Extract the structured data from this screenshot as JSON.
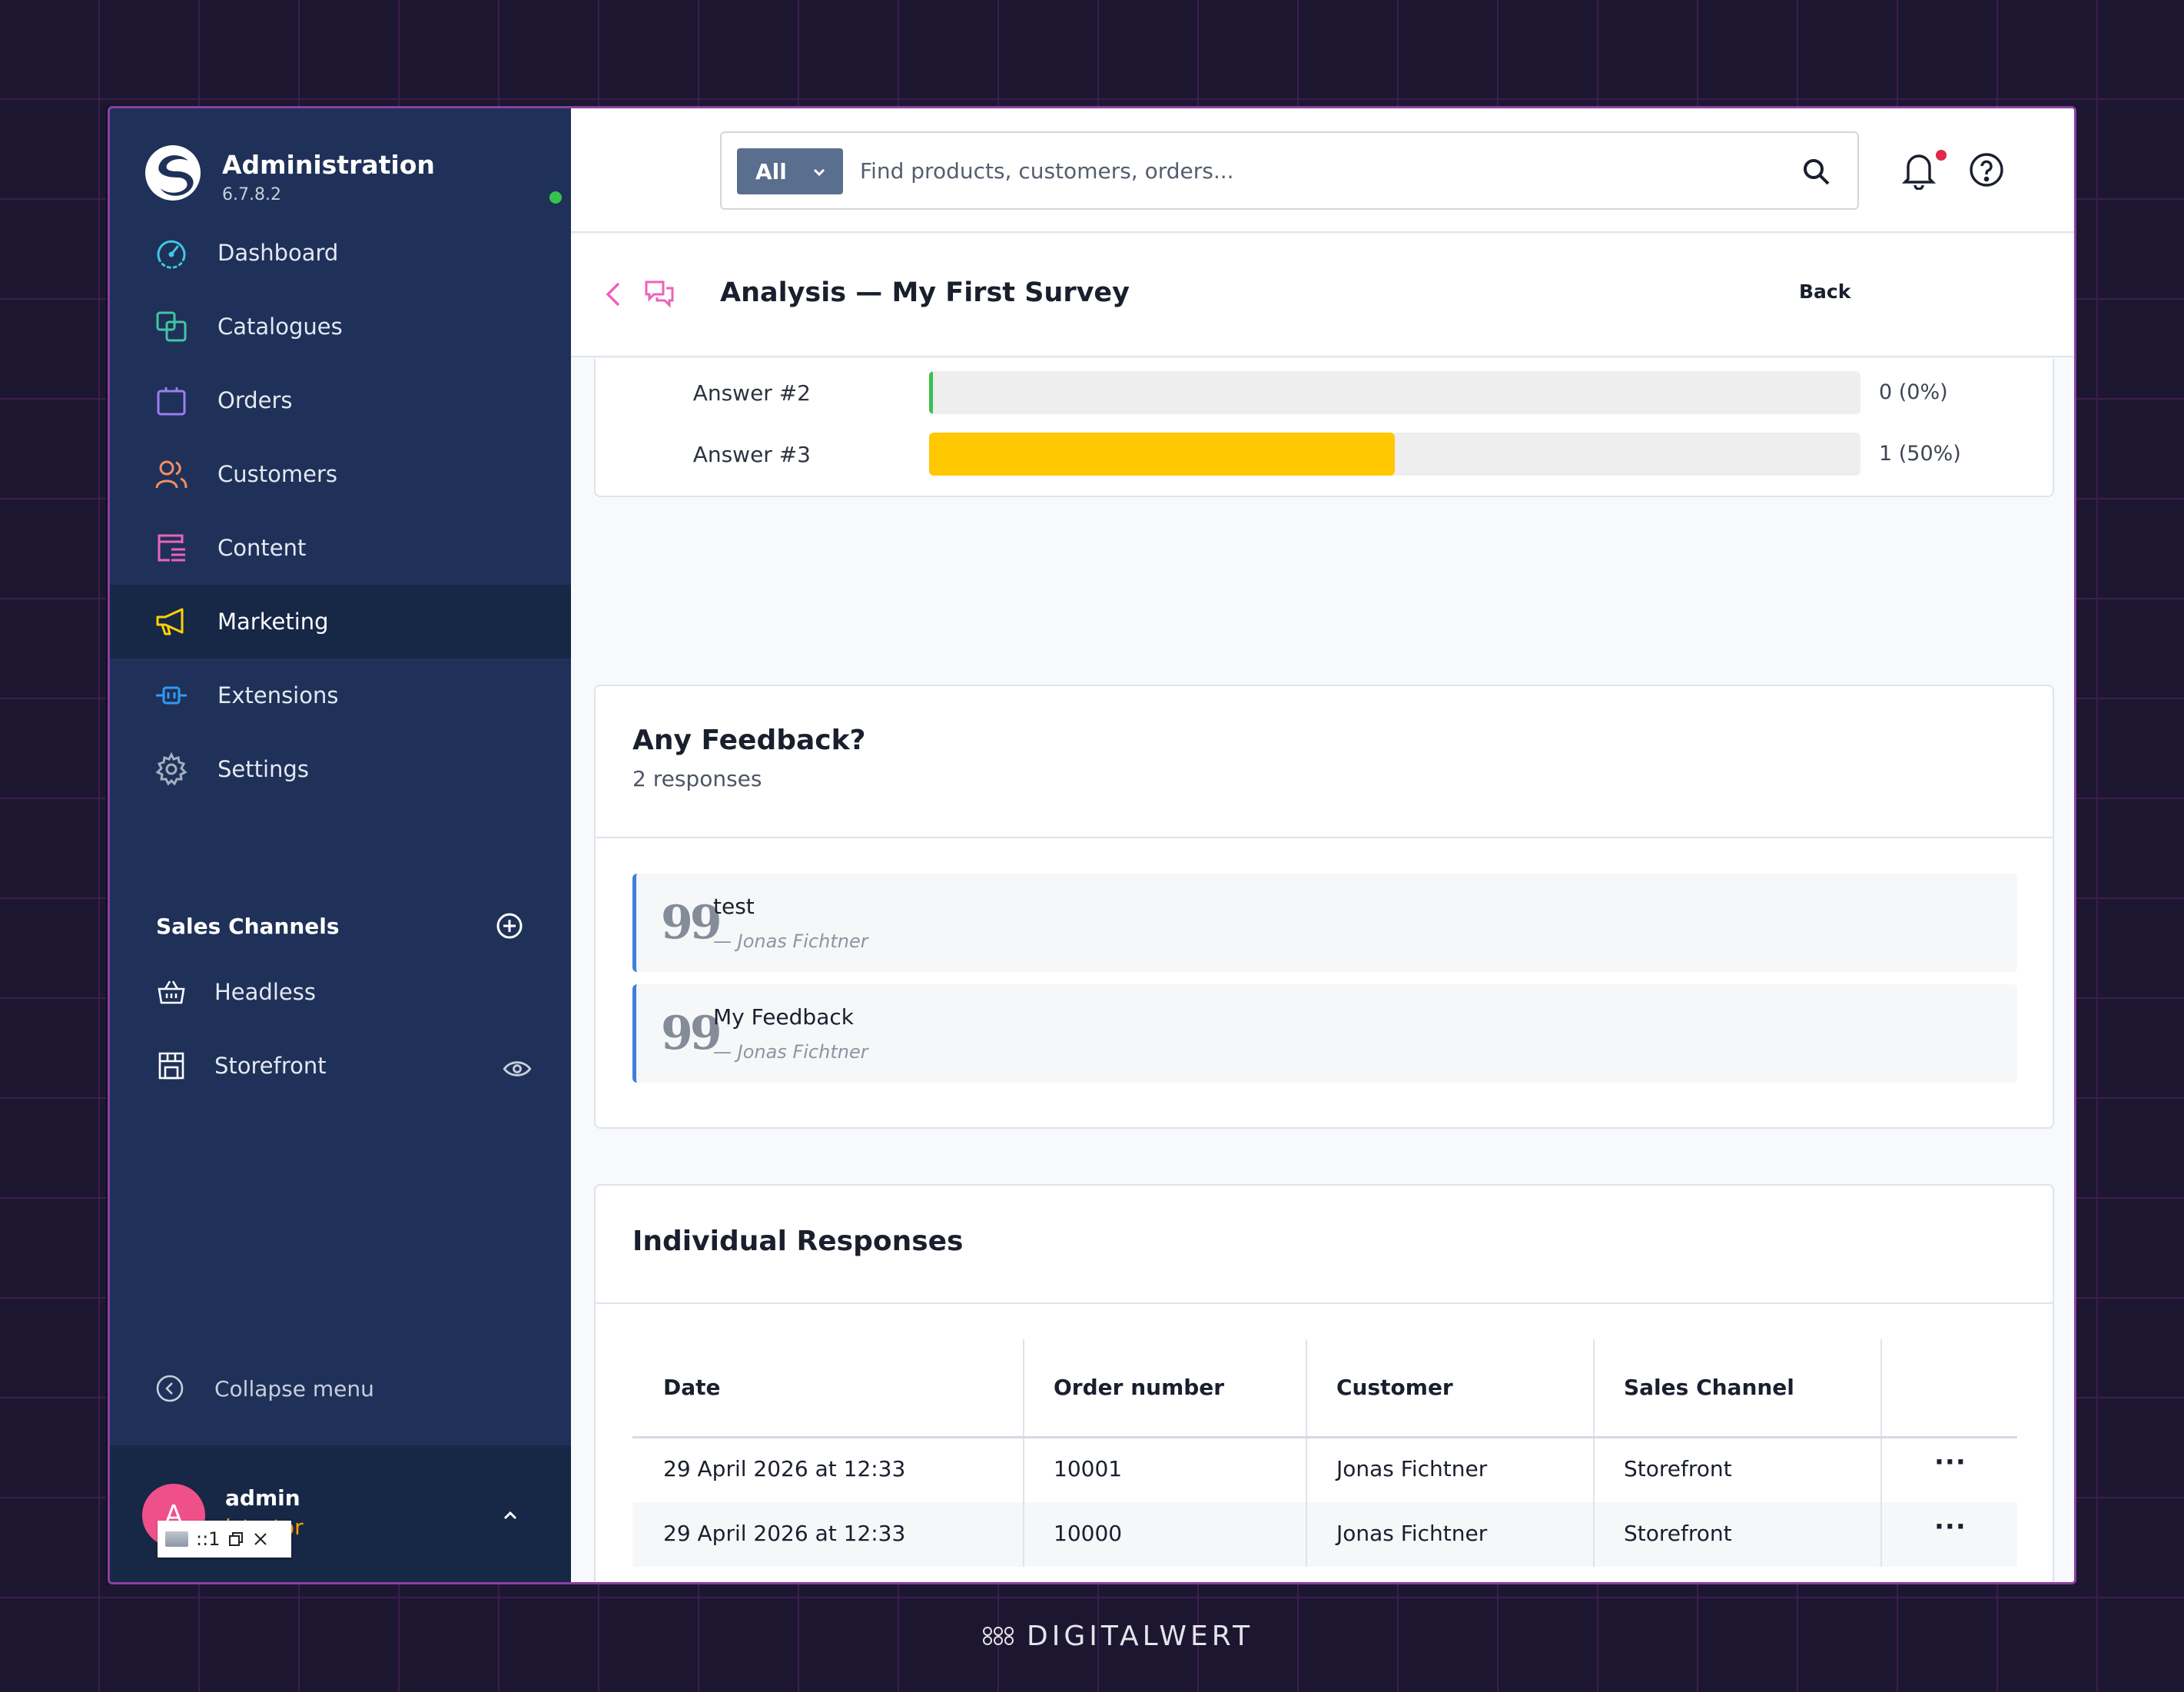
{
  "sidebar": {
    "brand_title": "Administration",
    "version": "6.7.8.2",
    "nav": [
      {
        "label": "Dashboard",
        "icon": "gauge-icon",
        "color": "#3fc8e4"
      },
      {
        "label": "Catalogues",
        "icon": "catalogue-icon",
        "color": "#42c6a4"
      },
      {
        "label": "Orders",
        "icon": "shopping-bag-icon",
        "color": "#9b7ef0"
      },
      {
        "label": "Customers",
        "icon": "users-icon",
        "color": "#f58e63"
      },
      {
        "label": "Content",
        "icon": "content-icon",
        "color": "#ee62b9"
      },
      {
        "label": "Marketing",
        "icon": "megaphone-icon",
        "color": "#ffd100",
        "active": true
      },
      {
        "label": "Extensions",
        "icon": "plugin-icon",
        "color": "#2f9bf5"
      },
      {
        "label": "Settings",
        "icon": "gear-icon",
        "color": "#a6aec0"
      }
    ],
    "sales_channels_title": "Sales Channels",
    "channels": [
      {
        "label": "Headless",
        "icon": "basket-icon"
      },
      {
        "label": "Storefront",
        "icon": "storefront-icon"
      }
    ],
    "collapse_label": "Collapse menu",
    "user": {
      "avatar_initial": "A",
      "name": "admin",
      "role_visible": "istrator",
      "tooltip_text": "::1"
    }
  },
  "topbar": {
    "search_type": "All",
    "search_placeholder": "Find products, customers, orders..."
  },
  "header": {
    "title": "Analysis — My First Survey",
    "back_label": "Back"
  },
  "answers": [
    {
      "label": "Answer #2",
      "value_text": "0 (0%)",
      "fraction": 0.0,
      "color": "#37c24d"
    },
    {
      "label": "Answer #3",
      "value_text": "1 (50%)",
      "fraction": 0.5,
      "color": "#ffc800"
    }
  ],
  "feedback": {
    "title": "Any Feedback?",
    "subtitle": "2 responses",
    "quotes": [
      {
        "text": "test",
        "author": "— Jonas Fichtner"
      },
      {
        "text": "My Feedback",
        "author": "— Jonas Fichtner"
      }
    ]
  },
  "responses": {
    "title": "Individual Responses",
    "columns": [
      "Date",
      "Order number",
      "Customer",
      "Sales Channel"
    ],
    "rows": [
      [
        "29 April 2026 at 12:33",
        "10001",
        "Jonas Fichtner",
        "Storefront"
      ],
      [
        "29 April 2026 at 12:33",
        "10000",
        "Jonas Fichtner",
        "Storefront"
      ]
    ],
    "row_action": "···"
  },
  "watermark": "DIGITALWERT"
}
